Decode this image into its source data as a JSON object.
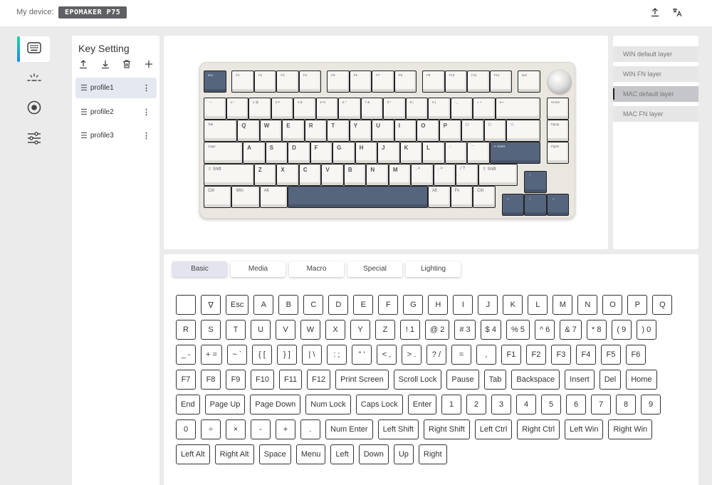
{
  "header": {
    "device_label": "My device:",
    "device_name": "EPOMAKER P75",
    "icons": [
      "upload-icon",
      "translate-icon"
    ]
  },
  "nav": {
    "items": [
      {
        "name": "keyboard",
        "icon": "keyboard-icon",
        "active": true
      },
      {
        "name": "lighting",
        "icon": "light-icon",
        "active": false
      },
      {
        "name": "macro",
        "icon": "record-icon",
        "active": false
      },
      {
        "name": "settings",
        "icon": "sliders-icon",
        "active": false
      }
    ]
  },
  "profiles": {
    "title": "Key Setting",
    "tools": [
      "export-icon",
      "import-icon",
      "trash-icon",
      "add-icon"
    ],
    "items": [
      {
        "label": "profile1",
        "active": true
      },
      {
        "label": "profile2",
        "active": false
      },
      {
        "label": "profile3",
        "active": false
      }
    ]
  },
  "layers": {
    "items": [
      {
        "label": "WIN default layer",
        "active": false
      },
      {
        "label": "WIN FN layer",
        "active": false
      },
      {
        "label": "MAC default layer",
        "active": true
      },
      {
        "label": "MAC FN layer",
        "active": false
      }
    ]
  },
  "keyboard_image": {
    "rows": [
      [
        "Esc",
        "F1",
        "F2",
        "F3",
        "F4",
        "F5",
        "F6",
        "F7",
        "F8",
        "F9",
        "F10",
        "F11",
        "F12",
        "Del"
      ],
      [
        "` ~",
        "1 !",
        "2 @",
        "3 #",
        "4 $",
        "5 %",
        "6 ^",
        "7 &",
        "8 *",
        "9 (",
        "0 )",
        "- _",
        "= +",
        "⟵",
        "Home"
      ],
      [
        "Tab",
        "Q",
        "W",
        "E",
        "R",
        "T",
        "Y",
        "U",
        "I",
        "O",
        "P",
        "[ {",
        "] }",
        "\\ |",
        "PgUp"
      ],
      [
        "Caps",
        "A",
        "S",
        "D",
        "F",
        "G",
        "H",
        "J",
        "K",
        "L",
        "; :",
        "' \"",
        "↵ Enter",
        "PgDn"
      ],
      [
        "⇧ Shift",
        "Z",
        "X",
        "C",
        "V",
        "B",
        "N",
        "M",
        ", <",
        ". >",
        "/ ?",
        "⇧ Shift",
        "↑"
      ],
      [
        "Ctrl",
        "Win",
        "Alt",
        "",
        "Alt",
        "Fn",
        "Ctrl",
        "←",
        "↓",
        "→"
      ]
    ]
  },
  "tabs": [
    {
      "label": "Basic",
      "active": true
    },
    {
      "label": "Media",
      "active": false
    },
    {
      "label": "Macro",
      "active": false
    },
    {
      "label": "Special",
      "active": false
    },
    {
      "label": "Lighting",
      "active": false
    }
  ],
  "key_grid": [
    [
      "",
      "∇",
      "Esc",
      "A",
      "B",
      "C",
      "D",
      "E",
      "F",
      "G",
      "H",
      "I",
      "J",
      "K",
      "L",
      "M",
      "N",
      "O",
      "P",
      "Q"
    ],
    [
      "R",
      "S",
      "T",
      "U",
      "V",
      "W",
      "X",
      "Y",
      "Z",
      "! 1",
      "@ 2",
      "# 3",
      "$ 4",
      "% 5",
      "^ 6",
      "& 7",
      "* 8",
      "( 9",
      ") 0"
    ],
    [
      "_ -",
      "+ =",
      "~ `",
      "{ [",
      "} ]",
      "| \\",
      ": ;",
      "\" '",
      "< ,",
      "> .",
      "? /",
      "=",
      ",",
      "F1",
      "F2",
      "F3",
      "F4",
      "F5",
      "F6"
    ],
    [
      "F7",
      "F8",
      "F9",
      "F10",
      "F11",
      "F12",
      "Print Screen",
      "Scroll Lock",
      "Pause",
      "Tab",
      "Backspace",
      "Insert",
      "Del",
      "Home"
    ],
    [
      "End",
      "Page Up",
      "Page Down",
      "Num Lock",
      "Caps Lock",
      "Enter",
      "1",
      "2",
      "3",
      "4",
      "5",
      "6",
      "7",
      "8",
      "9"
    ],
    [
      "0",
      "÷",
      "×",
      "-",
      "+",
      ".",
      "Num Enter",
      "Left Shift",
      "Right Shift",
      "Left Ctrl",
      "Right Ctrl",
      "Left Win",
      "Right Win"
    ],
    [
      "Left Alt",
      "Right Alt",
      "Space",
      "Menu",
      "Left",
      "Down",
      "Up",
      "Right"
    ]
  ]
}
